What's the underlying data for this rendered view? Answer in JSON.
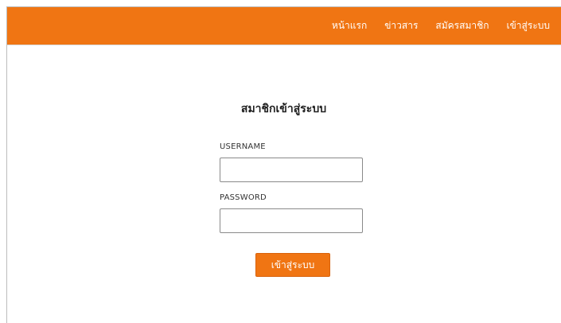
{
  "nav": {
    "items": [
      {
        "label": "หน้าแรก"
      },
      {
        "label": "ข่าวสาร"
      },
      {
        "label": "สมัครสมาชิก"
      },
      {
        "label": "เข้าสู่ระบบ"
      }
    ]
  },
  "login": {
    "title": "สมาชิกเข้าสู่ระบบ",
    "username_label": "USERNAME",
    "username_value": "",
    "password_label": "PASSWORD",
    "password_value": "",
    "submit_label": "เข้าสู่ระบบ"
  },
  "colors": {
    "accent": "#f07513",
    "background": "#ffffff"
  }
}
